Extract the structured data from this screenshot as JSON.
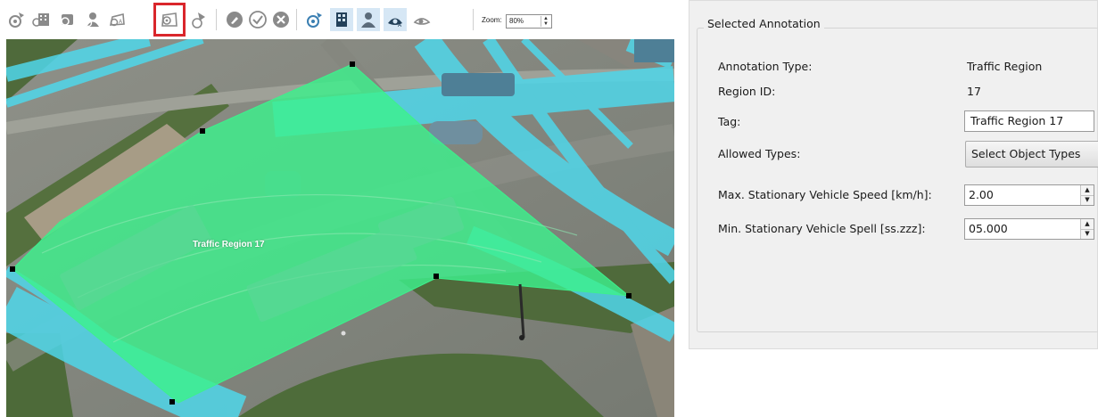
{
  "toolbar": {
    "tools": [
      {
        "name": "pointer-tool-icon"
      },
      {
        "name": "add-building-tool-icon"
      },
      {
        "name": "add-car-tool-icon"
      },
      {
        "name": "add-person-tool-icon"
      },
      {
        "name": "add-traffic-region-tool-icon"
      },
      {
        "name": "add-region-point-tool-icon",
        "selected": true
      },
      {
        "name": "add-line-tool-icon"
      },
      {
        "name": "edit-tool-icon"
      },
      {
        "name": "accept-tool-icon"
      },
      {
        "name": "cancel-tool-icon"
      },
      {
        "name": "view-pointer-icon"
      },
      {
        "name": "view-buildings-icon"
      },
      {
        "name": "view-persons-icon"
      },
      {
        "name": "view-regions-icon"
      },
      {
        "name": "view-lines-icon"
      }
    ],
    "zoom_label": "Zoom:",
    "zoom_value": "80%"
  },
  "view": {
    "region_label": "Traffic Region 17",
    "region_color": "#3df08c",
    "trajectory_color": "#4fd7ea"
  },
  "panel": {
    "group_title": "Selected Annotation",
    "annotation_type_label": "Annotation Type:",
    "annotation_type_value": "Traffic Region",
    "region_id_label": "Region ID:",
    "region_id_value": "17",
    "tag_label": "Tag:",
    "tag_value": "Traffic Region 17",
    "allowed_types_label": "Allowed Types:",
    "allowed_types_button": "Select Object Types",
    "max_speed_label": "Max. Stationary Vehicle Speed [km/h]:",
    "max_speed_value": "2.00",
    "min_spell_label": "Min. Stationary Vehicle Spell [ss.zzz]:",
    "min_spell_value": "05.000"
  }
}
